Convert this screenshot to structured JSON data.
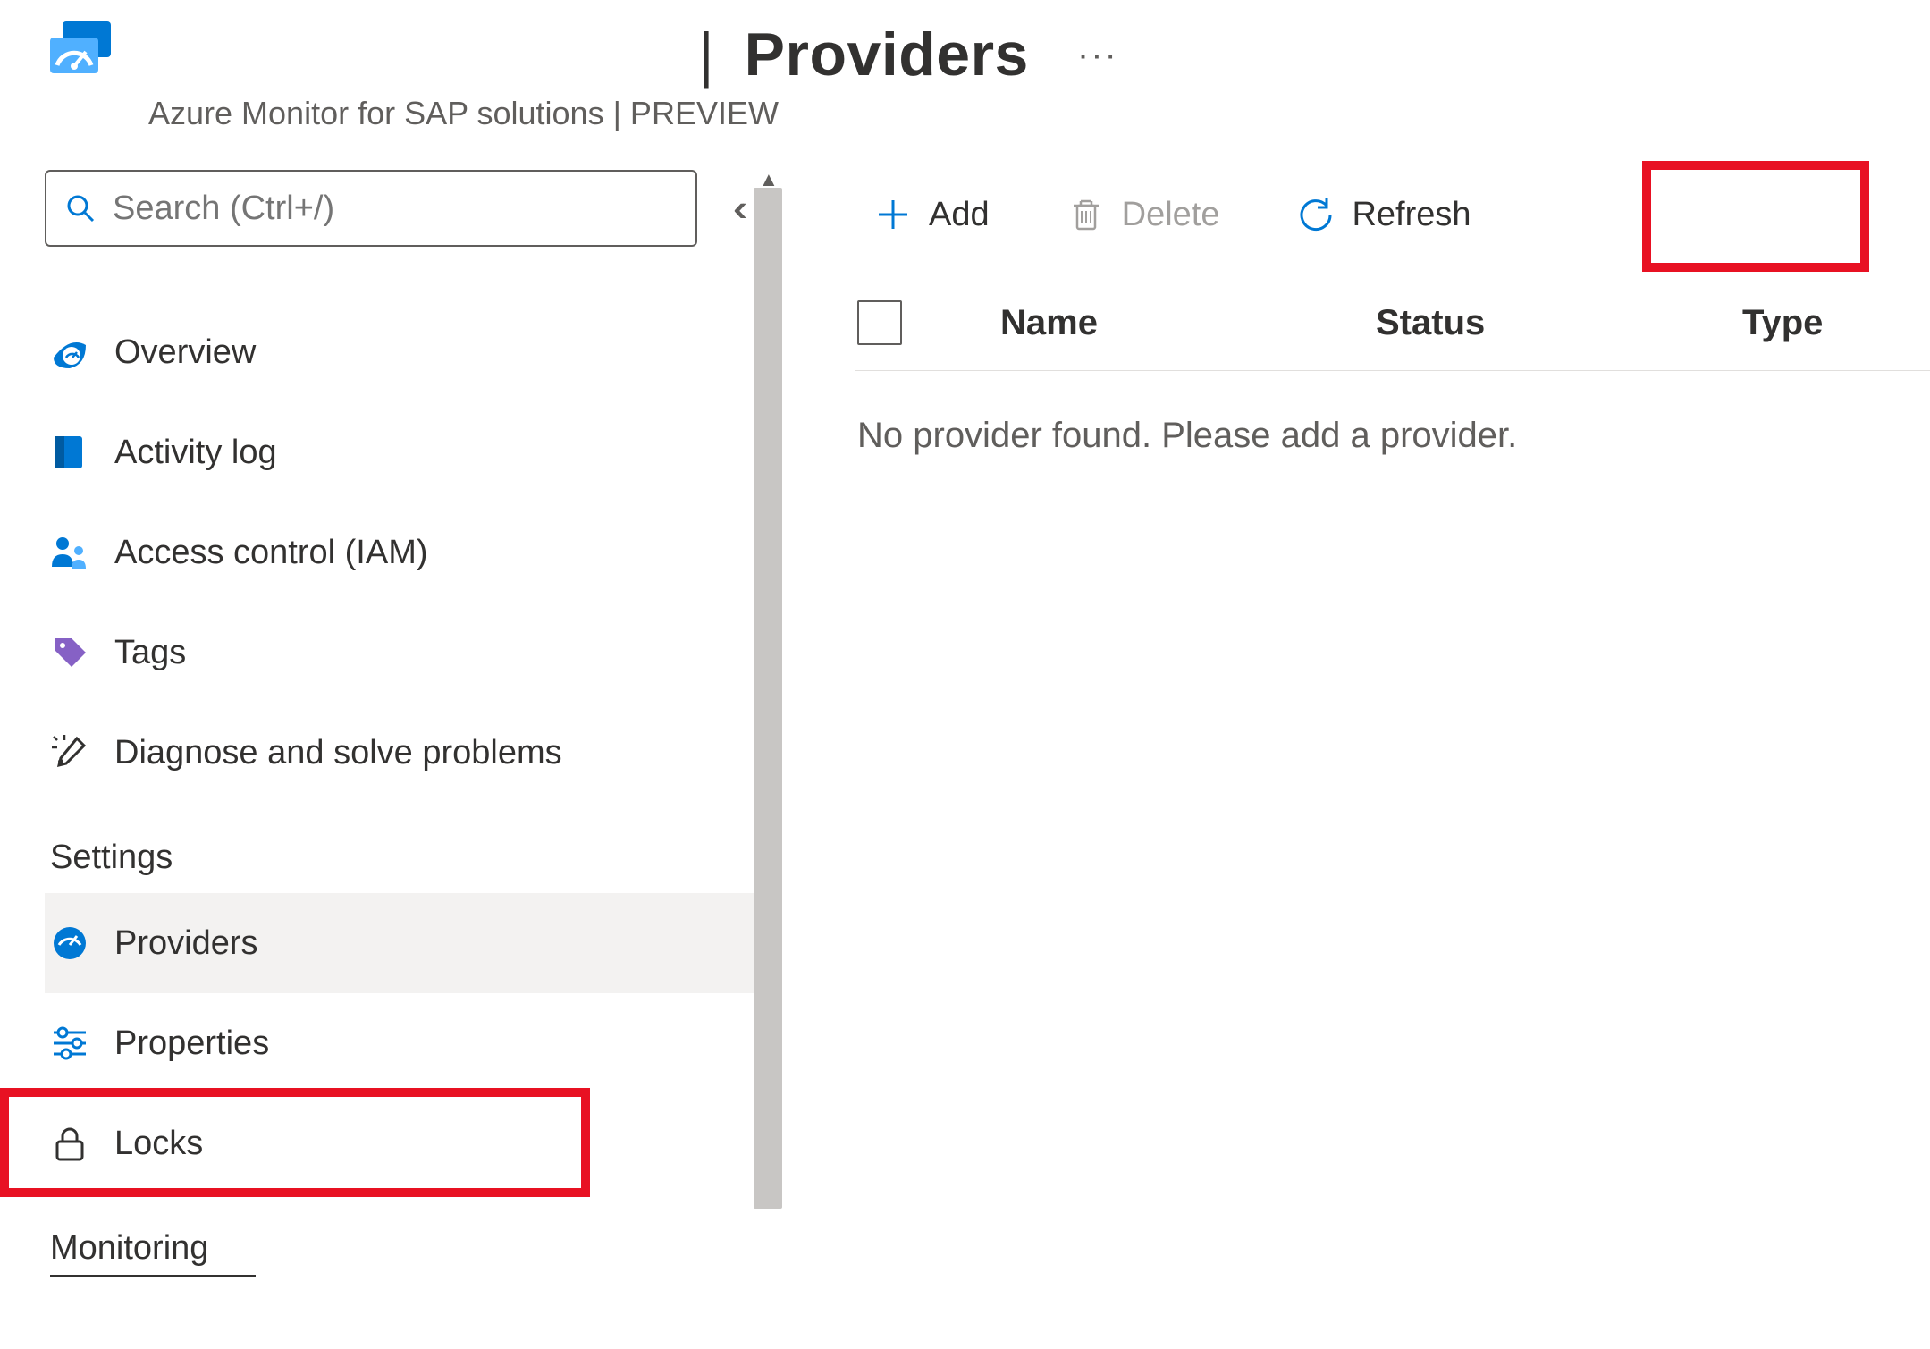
{
  "header": {
    "title_sep": "|",
    "title": "Providers",
    "title_dots": "···",
    "subtitle": "Azure Monitor for SAP solutions | PREVIEW"
  },
  "search": {
    "placeholder": "Search (Ctrl+/)"
  },
  "sidebar": {
    "items": [
      {
        "label": "Overview"
      },
      {
        "label": "Activity log"
      },
      {
        "label": "Access control (IAM)"
      },
      {
        "label": "Tags"
      },
      {
        "label": "Diagnose and solve problems"
      }
    ],
    "sections": [
      {
        "title": "Settings",
        "items": [
          {
            "label": "Providers",
            "selected": true
          },
          {
            "label": "Properties"
          },
          {
            "label": "Locks"
          }
        ]
      },
      {
        "title": "Monitoring",
        "items": []
      }
    ]
  },
  "toolbar": {
    "add_label": "Add",
    "delete_label": "Delete",
    "refresh_label": "Refresh"
  },
  "table": {
    "col_name": "Name",
    "col_status": "Status",
    "col_type": "Type",
    "empty_message": "No provider found. Please add a provider."
  }
}
